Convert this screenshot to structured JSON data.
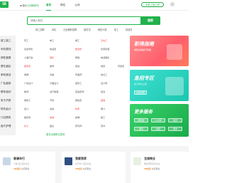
{
  "brand": {
    "logo_text": "58",
    "accent": "#22b14c"
  },
  "header": {
    "location": "徐州",
    "switch_label": "[切换城市]",
    "nav": [
      "首页",
      "职位",
      "公司"
    ],
    "phone_label": "手机上找工作"
  },
  "search": {
    "placeholder": "请输入职位",
    "button_label": "搜索",
    "hot_words": [
      "普工招聘",
      "司机",
      "日结兼职招聘",
      "服务员",
      "销售代表",
      "电工",
      "快递员"
    ]
  },
  "categories": [
    {
      "name": "普工|技工",
      "subs": [
        "普工",
        "电工",
        "焊工",
        "叉车工"
      ]
    },
    {
      "name": "司机|物流",
      "subs": [
        "货运司机",
        "快递员",
        "配送员",
        "仓库管理"
      ]
    },
    {
      "name": "销售|客服",
      "subs": [
        "人事行政",
        "销售",
        "网销",
        "电话销售"
      ]
    },
    {
      "name": "餐饮|酒店",
      "subs": [
        "服务员",
        "厨师",
        "保洁",
        "保安",
        "传菜员"
      ]
    },
    {
      "name": "家政|保洁",
      "subs": [
        "保姆",
        "月嫂",
        "育婴师",
        "钟点工"
      ]
    },
    {
      "name": "广告|装修",
      "subs": [
        "广告设计",
        "平面设计",
        "装修工",
        "设计师"
      ]
    },
    {
      "name": "教育|培训",
      "subs": [
        "教师",
        "资产助理",
        "英语老师",
        "培训"
      ]
    },
    {
      "name": "电子|汽修",
      "subs": [
        "维修工",
        "汽修",
        "质检员",
        "美容"
      ]
    },
    {
      "name": "财务|会计",
      "subs": [
        "会计",
        "出纳",
        "财务",
        "审计"
      ]
    },
    {
      "name": "IT|互联网",
      "subs": [
        "程序员",
        "运维",
        "前端",
        "美工"
      ]
    },
    {
      "name": "医疗|护理",
      "subs": [
        "护士",
        "医生",
        "药剂师",
        "营养"
      ]
    }
  ],
  "more_label": "更多全部职位类别",
  "promos": [
    {
      "title": "职场指南",
      "subtitle": "求职必看技巧攻略"
    },
    {
      "title": "急招专区",
      "subtitle": "好工作马上来",
      "cta": "点击查看"
    },
    {
      "title": "更多服务",
      "pills": [
        "招聘会",
        "人才库",
        "简历",
        "兼职",
        "校园",
        "留学"
      ]
    }
  ],
  "companies": [
    {
      "name": "靠谱车行",
      "desc": "汽车行业 民营企业",
      "vip": "VIP会员",
      "jobs": "在招职位"
    },
    {
      "name": "我要我家",
      "desc": "房产中介 民营企业",
      "vip": "VIP会员",
      "jobs": "在招职位"
    },
    {
      "name": "龙湖物业",
      "desc": "物业管理 民营企业",
      "vip": "VIP会员",
      "jobs": "在招职位"
    }
  ]
}
